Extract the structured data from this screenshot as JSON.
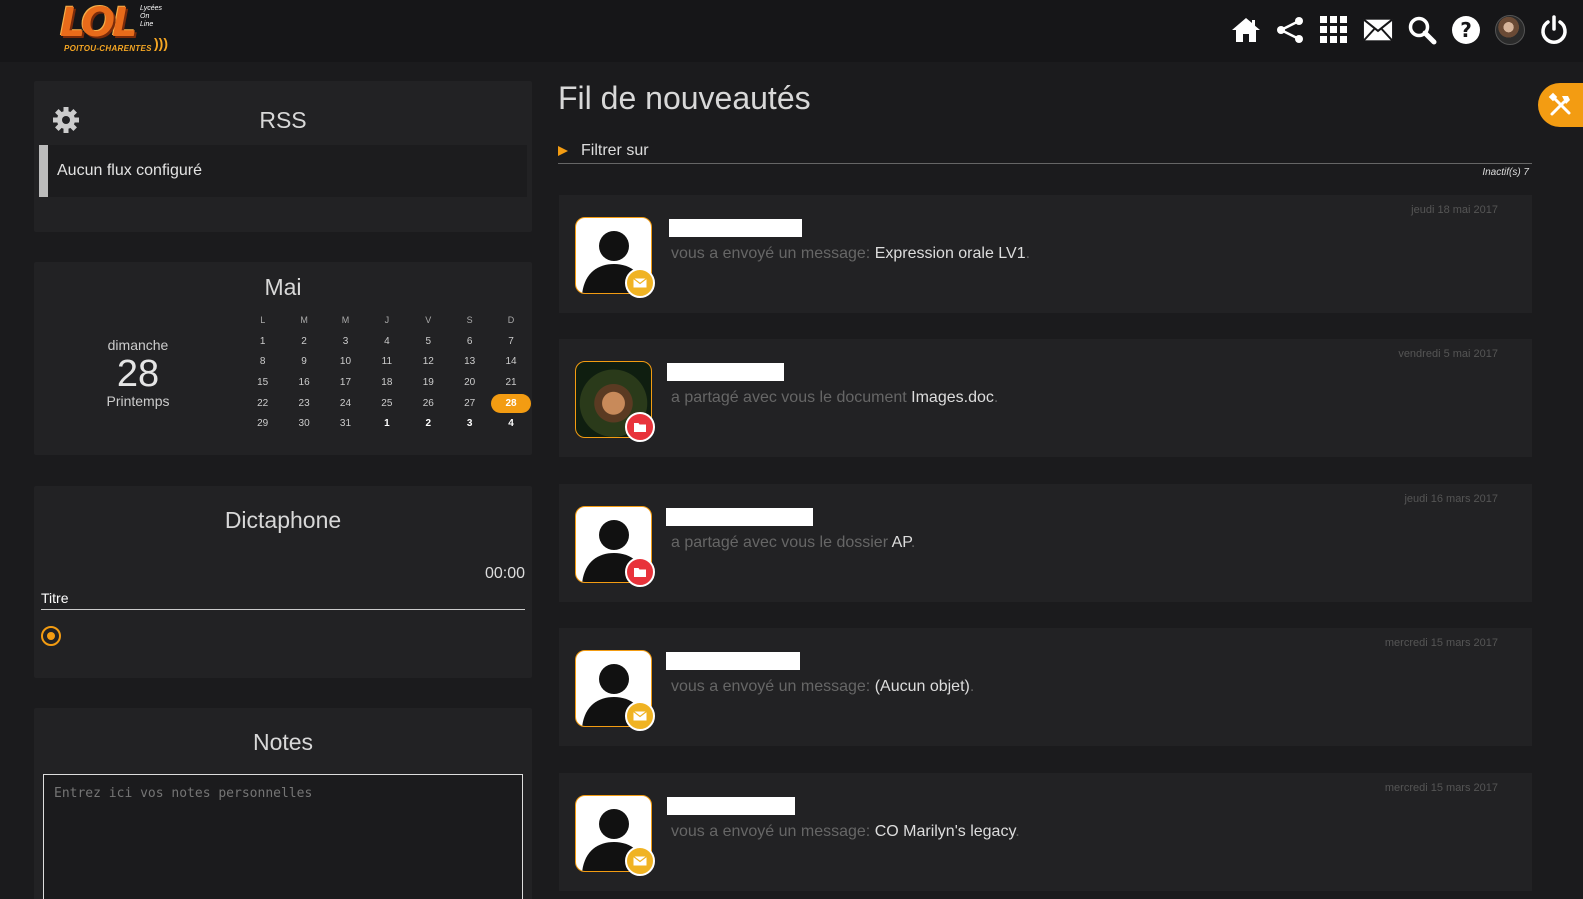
{
  "logo": {
    "main": "LOL",
    "sub_lines": [
      "Lycées",
      "On",
      "Line"
    ],
    "region": "POITOU-CHARENTES"
  },
  "nav": {
    "icons": [
      "home-icon",
      "share-icon",
      "apps-grid-icon",
      "mail-icon",
      "search-icon",
      "help-icon",
      "avatar",
      "power-icon"
    ]
  },
  "rss": {
    "title": "RSS",
    "empty_message": "Aucun flux configuré"
  },
  "calendar": {
    "month": "Mai",
    "weekday": "dimanche",
    "day": "28",
    "season": "Printemps",
    "headers": [
      "L",
      "M",
      "M",
      "J",
      "V",
      "S",
      "D"
    ],
    "weeks": [
      [
        "1",
        "2",
        "3",
        "4",
        "5",
        "6",
        "7"
      ],
      [
        "8",
        "9",
        "10",
        "11",
        "12",
        "13",
        "14"
      ],
      [
        "15",
        "16",
        "17",
        "18",
        "19",
        "20",
        "21"
      ],
      [
        "22",
        "23",
        "24",
        "25",
        "26",
        "27",
        "28"
      ],
      [
        "29",
        "30",
        "31",
        "1",
        "2",
        "3",
        "4"
      ]
    ],
    "today": "28"
  },
  "dictaphone": {
    "title": "Dictaphone",
    "time": "00:00",
    "field_label": "Titre"
  },
  "notes": {
    "title": "Notes",
    "placeholder": "Entrez ici vos notes personnelles"
  },
  "feed": {
    "title": "Fil de nouveautés",
    "filter_label": "Filtrer sur",
    "inactive": "Inactif(s) 7",
    "items": [
      {
        "action": "vous a envoyé un message: ",
        "object": "Expression orale LV1",
        "suffix": ".",
        "date": "jeudi 18 mai 2017",
        "badge": "mail"
      },
      {
        "action": "a partagé avec vous le document ",
        "object": "Images.doc",
        "suffix": ".",
        "date": "vendredi 5 mai 2017",
        "badge": "folder"
      },
      {
        "action": "a partagé avec vous le dossier ",
        "object": "AP",
        "suffix": ".",
        "date": "jeudi 16 mars 2017",
        "badge": "folder"
      },
      {
        "action": "vous a envoyé un message: ",
        "object": "(Aucun objet)",
        "suffix": ".",
        "date": "mercredi 15 mars 2017",
        "badge": "mail"
      },
      {
        "action": "vous a envoyé un message: ",
        "object": "CO Marilyn's legacy",
        "suffix": ".",
        "date": "mercredi 15 mars 2017",
        "badge": "mail"
      }
    ]
  },
  "colors": {
    "accent": "#f39c12",
    "mail_badge": "#f0b323",
    "folder_badge": "#e8333b",
    "background": "#1b1b1d",
    "panel": "#222224"
  }
}
